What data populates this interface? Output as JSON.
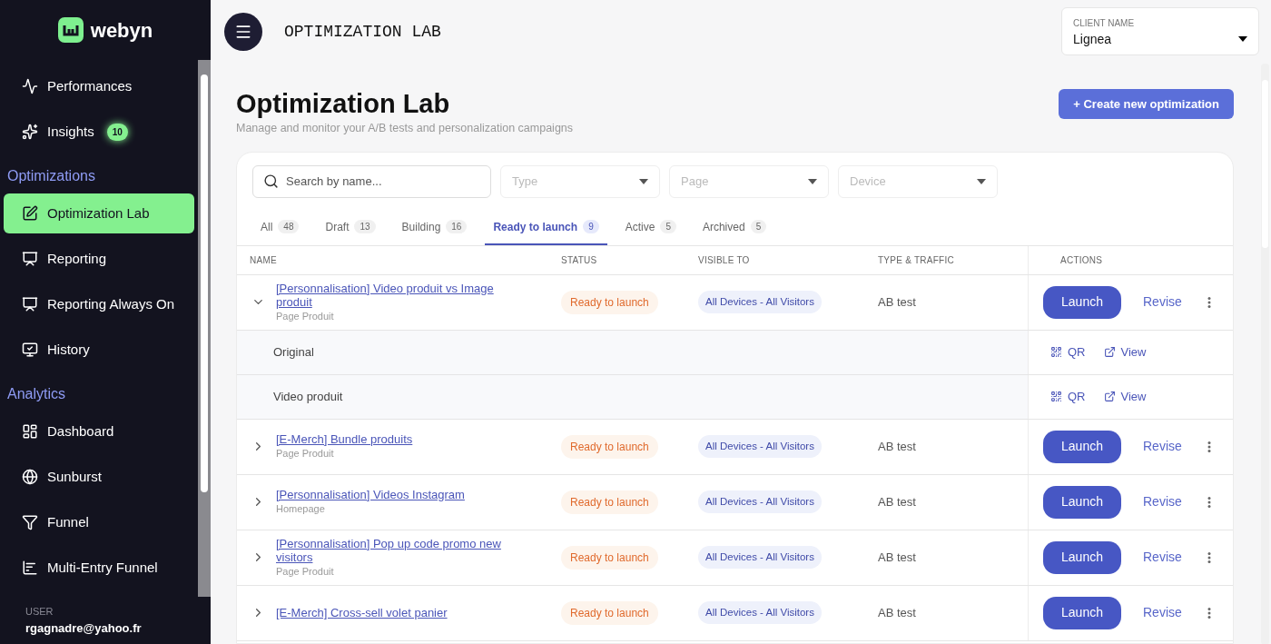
{
  "sidebar": {
    "logo": "webyn",
    "sections": [
      {
        "items": [
          {
            "label": "Performances",
            "selected": false
          },
          {
            "label": "Insights",
            "badge": "10",
            "selected": false
          }
        ]
      },
      {
        "heading": "Optimizations",
        "items": [
          {
            "label": "Optimization Lab",
            "selected": true
          },
          {
            "label": "Reporting",
            "selected": false
          },
          {
            "label": "Reporting Always On",
            "selected": false
          },
          {
            "label": "History",
            "selected": false
          }
        ]
      },
      {
        "heading": "Analytics",
        "items": [
          {
            "label": "Dashboard",
            "selected": false
          },
          {
            "label": "Sunburst",
            "selected": false
          },
          {
            "label": "Funnel",
            "selected": false
          },
          {
            "label": "Multi-Entry Funnel",
            "selected": false
          }
        ]
      }
    ],
    "user": {
      "label": "USER",
      "email": "rgagnadre@yahoo.fr"
    }
  },
  "header": {
    "title": "OPTIMIZATION LAB",
    "client": {
      "label": "CLIENT NAME",
      "value": "Lignea"
    }
  },
  "page": {
    "title": "Optimization Lab",
    "subtitle": "Manage and monitor your A/B tests and personalization campaigns",
    "create_button": "+ Create new optimization"
  },
  "filters": {
    "search": {
      "placeholder": "Search by name..."
    },
    "dropdowns": [
      {
        "placeholder": "Type"
      },
      {
        "placeholder": "Page"
      },
      {
        "placeholder": "Device"
      }
    ]
  },
  "tabs": [
    {
      "label": "All",
      "count": "48",
      "selected": false
    },
    {
      "label": "Draft",
      "count": "13",
      "selected": false
    },
    {
      "label": "Building",
      "count": "16",
      "selected": false
    },
    {
      "label": "Ready to launch",
      "count": "9",
      "selected": true
    },
    {
      "label": "Active",
      "count": "5",
      "selected": false
    },
    {
      "label": "Archived",
      "count": "5",
      "selected": false
    }
  ],
  "table": {
    "columns": [
      "NAME",
      "STATUS",
      "VISIBLE TO",
      "TYPE & TRAFFIC",
      "ACTIONS"
    ],
    "rows": [
      {
        "name": "[Personnalisation] Video produit vs Image produit",
        "page": "Page Produit",
        "status": "Ready to launch",
        "visible_to": "All Devices - All Visitors",
        "type": "AB test",
        "launch": "Launch",
        "revise": "Revise",
        "expanded": true,
        "variants": [
          {
            "name": "Original",
            "qr": "QR",
            "view": "View"
          },
          {
            "name": "Video produit",
            "qr": "QR",
            "view": "View"
          }
        ]
      },
      {
        "name": "[E-Merch] Bundle produits",
        "page": "Page Produit",
        "status": "Ready to launch",
        "visible_to": "All Devices - All Visitors",
        "type": "AB test",
        "launch": "Launch",
        "revise": "Revise",
        "expanded": false
      },
      {
        "name": "[Personnalisation] Videos Instagram",
        "page": "Homepage",
        "status": "Ready to launch",
        "visible_to": "All Devices - All Visitors",
        "type": "AB test",
        "launch": "Launch",
        "revise": "Revise",
        "expanded": false
      },
      {
        "name": "[Personnalisation] Pop up code promo new visitors",
        "page": "Page Produit",
        "status": "Ready to launch",
        "visible_to": "All Devices - All Visitors",
        "type": "AB test",
        "launch": "Launch",
        "revise": "Revise",
        "expanded": false
      },
      {
        "name": "[E-Merch] Cross-sell volet panier",
        "status": "Ready to launch",
        "visible_to": "All Devices - All Visitors",
        "type": "AB test",
        "launch": "Launch",
        "revise": "Revise",
        "expanded": false
      }
    ]
  }
}
